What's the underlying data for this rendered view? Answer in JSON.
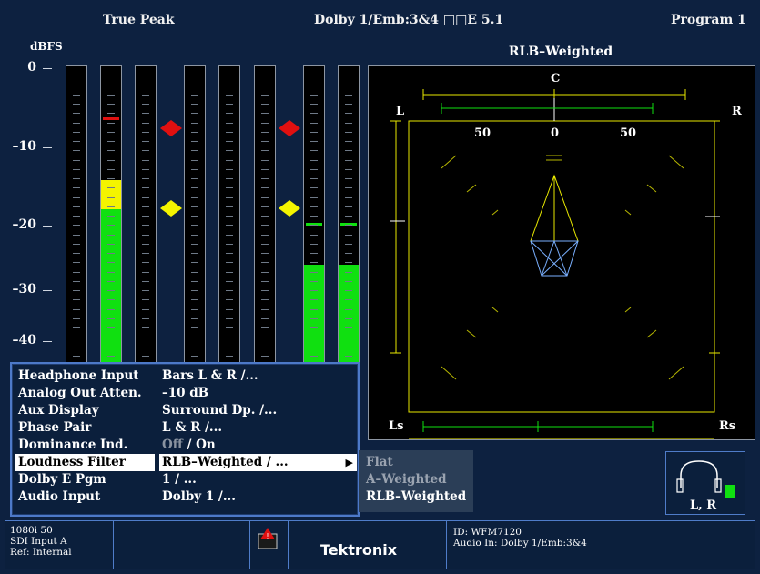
{
  "header": {
    "left_title": "True Peak",
    "center_title": "Dolby 1/Emb:3&4  □□E 5.1",
    "right_title": "Program 1"
  },
  "meters": {
    "unit_label": "dBFS",
    "scale_labels": [
      "0",
      "–10",
      "–20",
      "–30",
      "–40"
    ]
  },
  "sound_panel": {
    "title": "RLB–Weighted",
    "channel_labels": {
      "c": "C",
      "l": "L",
      "r": "R",
      "ls": "Ls",
      "rs": "Rs"
    },
    "percent_labels": [
      "50",
      "0",
      "50"
    ]
  },
  "menu": {
    "items": [
      {
        "label": "Headphone Input",
        "value": "Bars L & R /..."
      },
      {
        "label": "Analog Out Atten.",
        "value": "–10 dB"
      },
      {
        "label": "Aux Display",
        "value": "Surround Dp. /..."
      },
      {
        "label": "Phase Pair",
        "value": "L & R /..."
      },
      {
        "label": "Dominance Ind.",
        "value_dim": "Off",
        "value": " / On"
      },
      {
        "label": "Loudness Filter",
        "value": "RLB–Weighted / ...",
        "arrow": "▶"
      },
      {
        "label": "Dolby E Pgm",
        "value": "1 / ..."
      },
      {
        "label": "Audio Input",
        "value": "Dolby 1 /..."
      }
    ]
  },
  "submenu": {
    "options": [
      "Flat",
      "A–Weighted",
      "RLB–Weighted"
    ]
  },
  "headphone": {
    "label": "L, R"
  },
  "statusbar": {
    "format": "1080i 50",
    "input": "SDI Input A",
    "ref": "Ref: Internal",
    "logo": "Tektronix",
    "id": "ID: WFM7120",
    "audio_in": "Audio In: Dolby 1/Emb:3&4"
  },
  "colors": {
    "green": "#10e010",
    "yellow": "#f4f400",
    "red": "#e01010",
    "menu_border": "#4d79c8"
  }
}
